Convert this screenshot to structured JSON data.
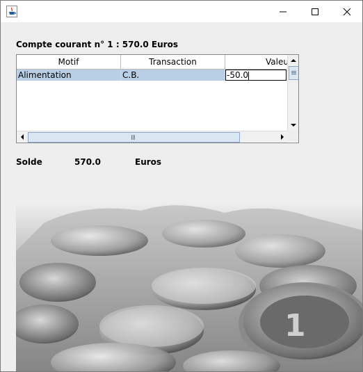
{
  "window": {
    "app_icon": "java-cup-icon",
    "controls": {
      "minimize": "minimize-icon",
      "maximize": "maximize-icon",
      "close": "close-icon"
    }
  },
  "account": {
    "label": "Compte courant n° 1 : 570.0 Euros"
  },
  "table": {
    "columns": [
      "Motif",
      "Transaction",
      "Valeu"
    ],
    "rows": [
      {
        "motif": "Alimentation",
        "transaction": "C.B.",
        "valeur": "-50.0"
      }
    ]
  },
  "balance": {
    "label": "Solde",
    "value": "570.0",
    "unit": "Euros"
  },
  "colors": {
    "selection": "#b8cfe5",
    "window_bg": "#eeeeee",
    "scroll_thumb": "#dbe6f3"
  },
  "image": {
    "subject": "euro coins"
  }
}
